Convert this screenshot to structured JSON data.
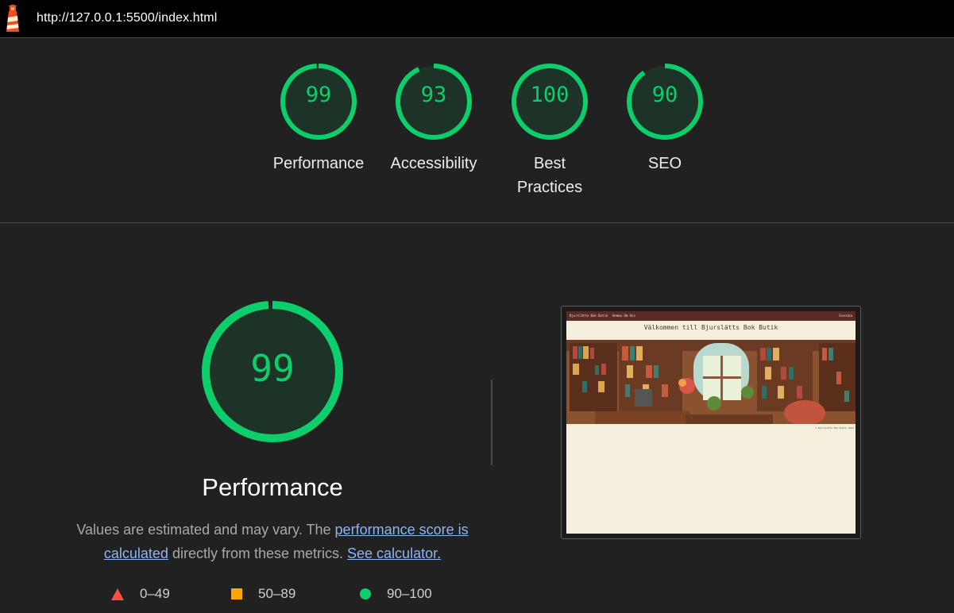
{
  "topbar": {
    "url": "http://127.0.0.1:5500/index.html",
    "icon": "lighthouse-icon"
  },
  "scores": [
    {
      "value": "99",
      "label": "Performance",
      "score": 99
    },
    {
      "value": "93",
      "label": "Accessibility",
      "score": 93
    },
    {
      "value": "100",
      "label": "Best Practices",
      "score": 100
    },
    {
      "value": "90",
      "label": "SEO",
      "score": 90
    }
  ],
  "performance": {
    "value": "99",
    "score": 99,
    "title": "Performance",
    "desc_prefix": "Values are estimated and may vary. The ",
    "desc_link1": "performance score is calculated",
    "desc_middle": " directly from these metrics. ",
    "desc_link2": "See calculator."
  },
  "legend": [
    {
      "range": "0–49",
      "icon": "triangle-icon",
      "color": "#ff4e42"
    },
    {
      "range": "50–89",
      "icon": "square-icon",
      "color": "#ffa400"
    },
    {
      "range": "90–100",
      "icon": "circle-icon",
      "color": "#0cce6b"
    }
  ],
  "screenshot": {
    "nav_brand": "Bjurslätta Bok Butik",
    "nav_links": "Hemma  Om Oss",
    "nav_lang": "Svenska",
    "heading": "Välkommen till Bjurslätts Bok Butik",
    "footer": "© Bjurslätta Bok Butik 2024"
  },
  "colors": {
    "pass": "#0cce6b",
    "average": "#ffa400",
    "fail": "#ff4e42",
    "link": "#8ab4f8"
  }
}
